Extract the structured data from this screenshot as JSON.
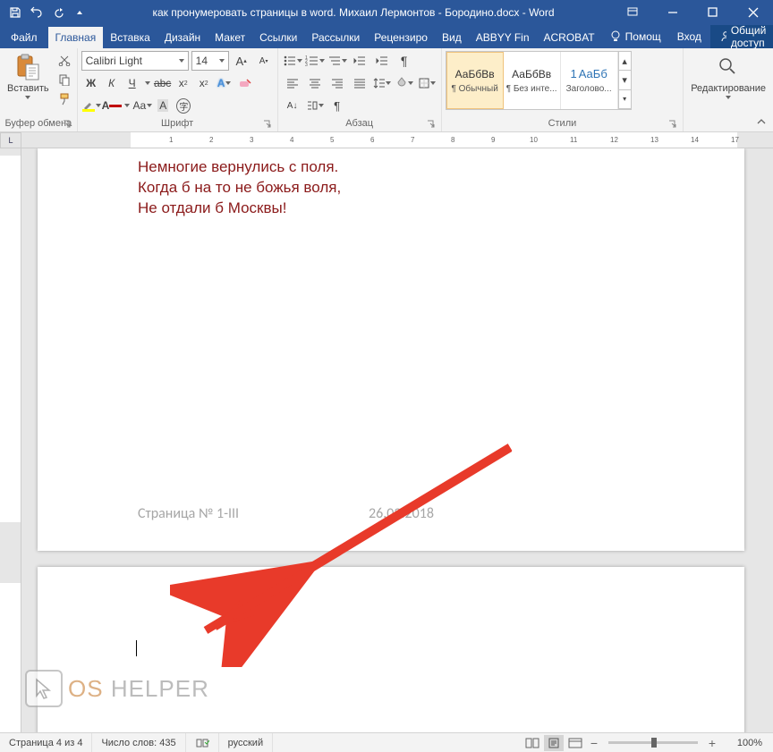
{
  "title": "как пронумеровать страницы в word. Михаил Лермонтов - Бородино.docx - Word",
  "tabs": {
    "file": "Файл",
    "home": "Главная",
    "insert": "Вставка",
    "design": "Дизайн",
    "layout": "Макет",
    "references": "Ссылки",
    "mailings": "Рассылки",
    "review": "Рецензиро",
    "view": "Вид",
    "abbyy": "ABBYY Fin",
    "acrobat": "ACROBAT"
  },
  "help": "Помощ",
  "login": "Вход",
  "share": "Общий доступ",
  "ribbon": {
    "clipboard": {
      "paste": "Вставить",
      "label": "Буфер обмена"
    },
    "font": {
      "name": "Calibri Light",
      "size": "14",
      "bold": "Ж",
      "italic": "К",
      "underline": "Ч",
      "label": "Шрифт"
    },
    "paragraph": {
      "label": "Абзац"
    },
    "styles": {
      "preview": "АаБбВв",
      "preview3": "АаБб",
      "s1": "¶ Обычный",
      "s2": "¶ Без инте...",
      "s3": "Заголово...",
      "num3": "1",
      "label": "Стили"
    },
    "editing": {
      "label": "Редактирование"
    }
  },
  "document": {
    "line1": "Немногие вернулись с поля.",
    "line2": "Когда б на то не божья воля,",
    "line3": "Не отдали б Москвы!",
    "footer_page": "Страница № 1-III",
    "footer_date": "26.02.2018"
  },
  "status": {
    "page": "Страница 4 из 4",
    "words": "Число слов: 435",
    "lang": "русский",
    "zoom": "100%"
  },
  "watermark": {
    "os": "OS",
    "helper": "HELPER"
  },
  "ruler_corner": "L"
}
